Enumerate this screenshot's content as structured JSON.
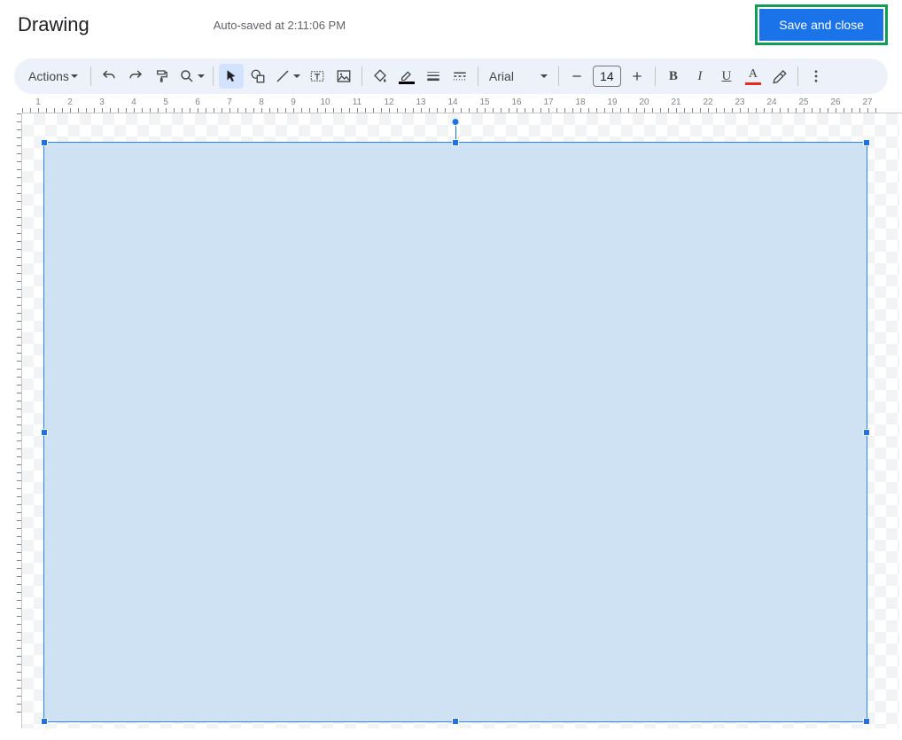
{
  "header": {
    "title": "Drawing",
    "autosave": "Auto-saved at 2:11:06 PM",
    "save_button": "Save and close"
  },
  "toolbar": {
    "actions": "Actions",
    "font_name": "Arial",
    "font_size": "14",
    "bold": "B",
    "italic": "I",
    "underline": "U",
    "textcolor": "A",
    "line_color_bar": "#000000",
    "text_color_bar": "#000000"
  },
  "ruler": {
    "h_units": [
      "1",
      "2",
      "3",
      "4",
      "5",
      "6",
      "7",
      "8",
      "9",
      "10",
      "11",
      "12",
      "13",
      "14",
      "15",
      "16",
      "17",
      "18",
      "19",
      "20",
      "21",
      "22",
      "23",
      "24",
      "25",
      "26",
      "27"
    ],
    "v_units": [
      "",
      "",
      "",
      "",
      "",
      "",
      "",
      "",
      "",
      "",
      "",
      "",
      "",
      "",
      "",
      "",
      "",
      "",
      ""
    ]
  },
  "canvas": {
    "selected_shape": {
      "type": "rectangle",
      "fill": "#cfe2f3",
      "selected": true
    }
  }
}
